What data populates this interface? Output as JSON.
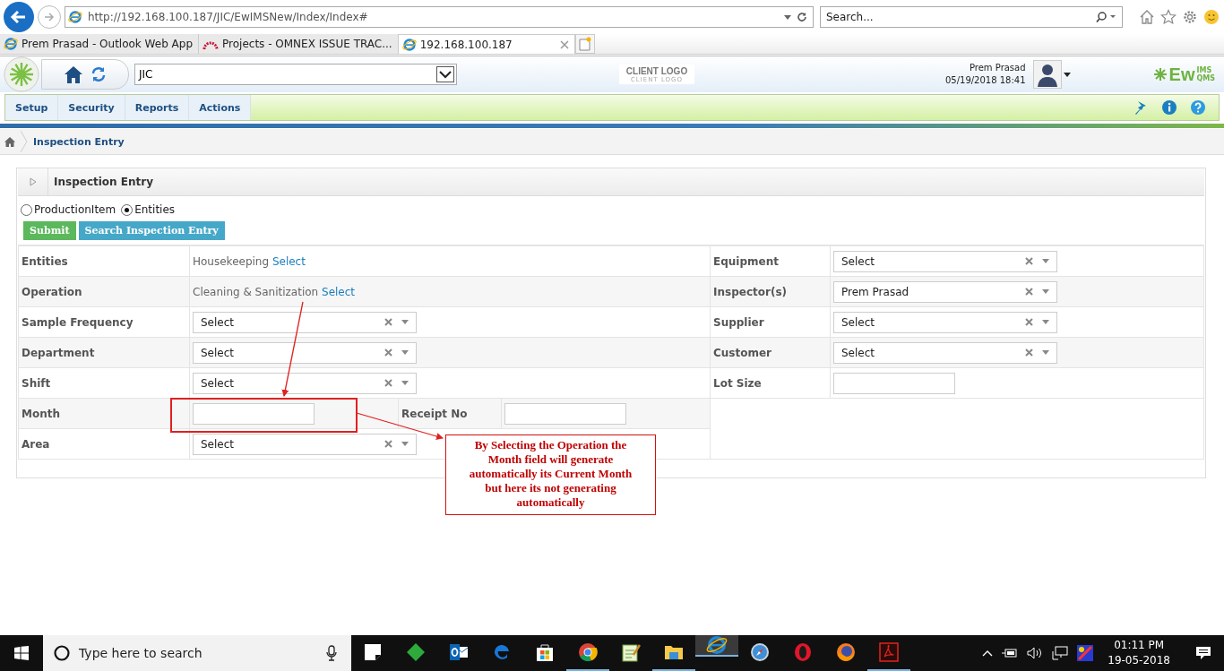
{
  "browser": {
    "address": "http://192.168.100.187/JIC/EwIMSNew/Index/Index#",
    "search_placeholder": "Search...",
    "tabs": [
      {
        "title": "Prem Prasad - Outlook Web App",
        "kind": "ie",
        "selected": false
      },
      {
        "title": "Projects - OMNEX ISSUE TRAC...",
        "kind": "arc",
        "selected": false
      },
      {
        "title": "192.168.100.187",
        "kind": "ie",
        "selected": true
      }
    ]
  },
  "header": {
    "company": "JIC",
    "client_logo": "CLIENT LOGO",
    "client_logo_sub": "CLIENT LOGO",
    "user": "Prem Prasad",
    "datetime": "05/19/2018 18:41",
    "brand": "Ew",
    "brand_top": "IMS",
    "brand_bottom": "QMS"
  },
  "menu": [
    {
      "label": "Setup"
    },
    {
      "label": "Security"
    },
    {
      "label": "Reports"
    },
    {
      "label": "Actions"
    }
  ],
  "breadcrumb": "Inspection Entry",
  "panel": {
    "title": "Inspection Entry",
    "modes": [
      {
        "label": "ProductionItem",
        "selected": false
      },
      {
        "label": "Entities",
        "selected": true
      }
    ],
    "buttons": [
      {
        "label": "Submit",
        "kind": "submit"
      },
      {
        "label": "Search Inspection Entry",
        "kind": "search"
      }
    ],
    "left_rows": [
      {
        "label": "Entities",
        "kind": "pick",
        "value": "Housekeeping",
        "link": "Select"
      },
      {
        "label": "Operation",
        "kind": "pick",
        "value": "Cleaning & Sanitization",
        "link": "Select"
      },
      {
        "label": "Sample Frequency",
        "kind": "select",
        "value": "Select"
      },
      {
        "label": "Department",
        "kind": "select",
        "value": "Select"
      },
      {
        "label": "Shift",
        "kind": "select",
        "value": "Select"
      },
      {
        "label": "Month",
        "kind": "input",
        "extra_label": "Receipt No"
      },
      {
        "label": "Area",
        "kind": "select",
        "value": "Select"
      }
    ],
    "right_rows": [
      {
        "label": "Equipment",
        "kind": "select",
        "value": "Select"
      },
      {
        "label": "Inspector(s)",
        "kind": "select",
        "value": "Prem Prasad"
      },
      {
        "label": "Supplier",
        "kind": "select",
        "value": "Select"
      },
      {
        "label": "Customer",
        "kind": "select",
        "value": "Select"
      },
      {
        "label": "Lot Size",
        "kind": "input"
      }
    ]
  },
  "annotation": "By Selecting the Operation the Month field will generate automatically its Current Month but here its not generating automatically",
  "taskbar": {
    "search_placeholder": "Type here to search",
    "apps": [
      {
        "kind": "notes",
        "running": false,
        "selected": false
      },
      {
        "kind": "diamond",
        "running": false,
        "selected": false
      },
      {
        "kind": "outlook",
        "running": false,
        "selected": false
      },
      {
        "kind": "edge",
        "running": false,
        "selected": false
      },
      {
        "kind": "store",
        "running": false,
        "selected": false
      },
      {
        "kind": "chrome",
        "running": true,
        "selected": false
      },
      {
        "kind": "notepad",
        "running": false,
        "selected": false
      },
      {
        "kind": "folder",
        "running": true,
        "selected": false
      },
      {
        "kind": "ie",
        "running": true,
        "selected": true
      },
      {
        "kind": "safari",
        "running": false,
        "selected": false
      },
      {
        "kind": "opera",
        "running": false,
        "selected": false
      },
      {
        "kind": "firefox",
        "running": false,
        "selected": false
      },
      {
        "kind": "acrobat",
        "running": true,
        "selected": false
      }
    ],
    "time": "01:11 PM",
    "date": "19-05-2018"
  }
}
